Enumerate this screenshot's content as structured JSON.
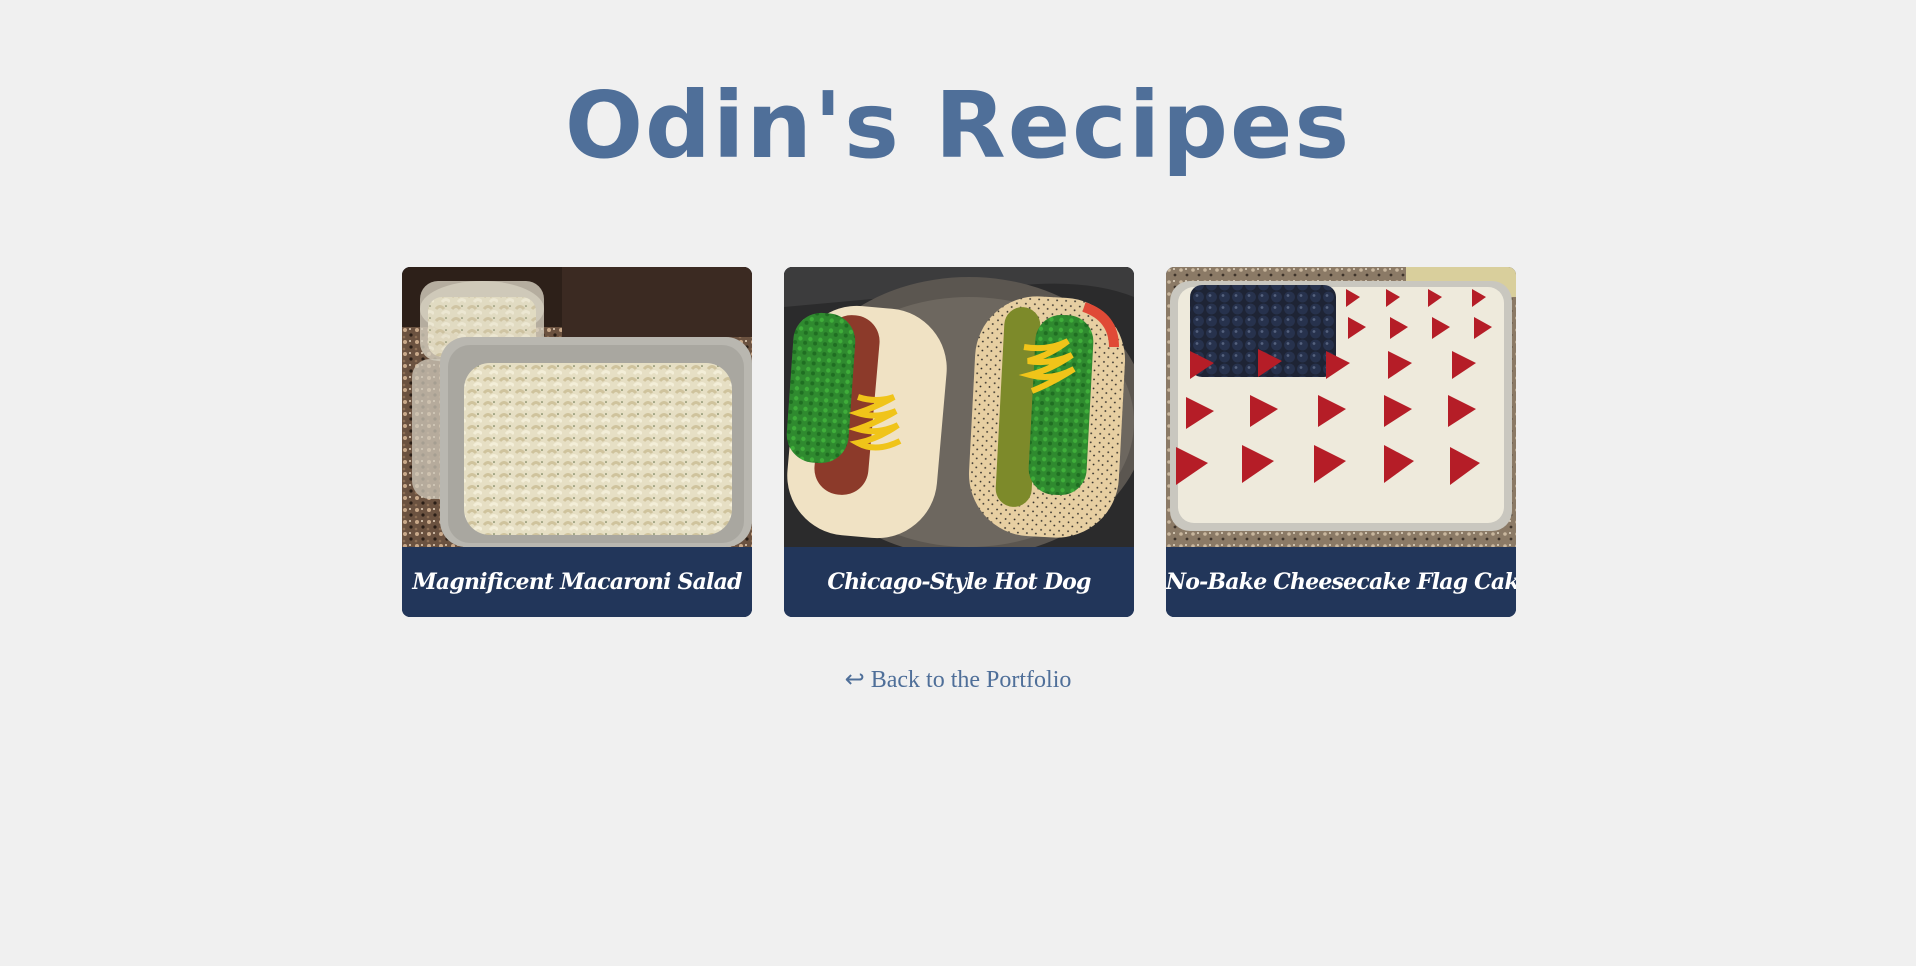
{
  "page": {
    "title": "Odin's Recipes",
    "background_color": "#f0f0f0",
    "accent_color": "#4f6f99",
    "caption_background": "#22365a"
  },
  "recipes": [
    {
      "label": "Magnificent Macaroni Salad",
      "image": "macaroni-salad-photo"
    },
    {
      "label": "Chicago-Style Hot Dog",
      "image": "hot-dog-photo"
    },
    {
      "label": "No-Bake Cheesecake Flag Cake",
      "image": "flag-cake-photo"
    }
  ],
  "footer": {
    "back_arrow": "↩",
    "back_label": "Back to the Portfolio"
  }
}
